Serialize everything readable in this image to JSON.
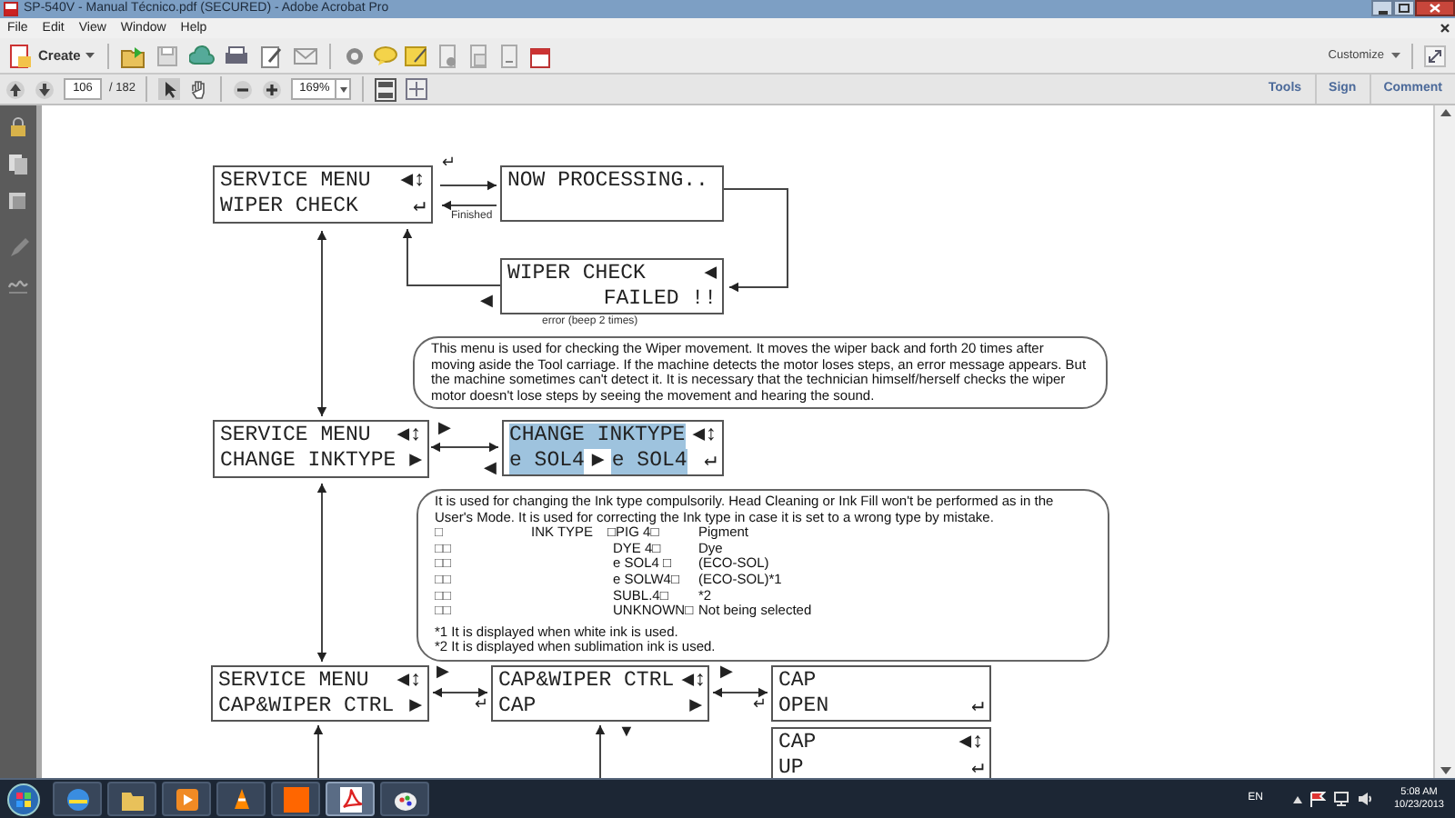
{
  "window": {
    "title": "SP-540V - Manual Técnico.pdf (SECURED) - Adobe Acrobat Pro"
  },
  "menu_bar": [
    {
      "label": "File"
    },
    {
      "label": "Edit"
    },
    {
      "label": "View"
    },
    {
      "label": "Window"
    },
    {
      "label": "Help"
    }
  ],
  "toolbar": {
    "create": "Create",
    "customize": "Customize"
  },
  "navigation": {
    "page": "106",
    "page_total": "/ 182",
    "zoom": "169%"
  },
  "panes": [
    {
      "label": "Tools"
    },
    {
      "label": "Sign"
    },
    {
      "label": "Comment"
    }
  ],
  "diagram": {
    "lcd_displays": [
      {
        "lines": [
          {
            "segments": [
              {
                "text": "SERVICE MENU",
                "highlighted": false
              }
            ],
            "end": "◀↕"
          },
          {
            "segments": [
              {
                "text": "WIPER CHECK",
                "highlighted": false
              }
            ],
            "end": "↵"
          }
        ]
      },
      {
        "lines": [
          {
            "segments": [
              {
                "text": "NOW PROCESSING..",
                "highlighted": false
              }
            ]
          }
        ]
      },
      {
        "lines": [
          {
            "segments": [
              {
                "text": "WIPER CHECK",
                "highlighted": false
              }
            ],
            "end": "◀"
          },
          {
            "end": "FAILED !!"
          }
        ]
      },
      {
        "lines": [
          {
            "segments": [
              {
                "text": "SERVICE MENU",
                "highlighted": false
              }
            ],
            "end": "◀↕"
          },
          {
            "segments": [
              {
                "text": "CHANGE INKTYPE",
                "highlighted": false
              }
            ],
            "end": "▶"
          }
        ]
      },
      {
        "lines": [
          {
            "segments": [
              {
                "text": "CHANGE INKTYPE",
                "highlighted": true
              }
            ],
            "end": "◀↕"
          },
          {
            "segments": [
              {
                "text": "e SOL4",
                "highlighted": true
              },
              {
                "text": "▶",
                "highlighted": false
              },
              {
                "text": "e SOL4",
                "highlighted": true
              }
            ],
            "end": "↵"
          }
        ]
      },
      {
        "lines": [
          {
            "segments": [
              {
                "text": "SERVICE MENU",
                "highlighted": false
              }
            ],
            "end": "◀↕"
          },
          {
            "segments": [
              {
                "text": "CAP&WIPER CTRL",
                "highlighted": false
              }
            ],
            "end": "▶"
          }
        ]
      },
      {
        "lines": [
          {
            "segments": [
              {
                "text": "CAP&WIPER CTRL",
                "highlighted": false
              }
            ],
            "end": "◀↕"
          },
          {
            "segments": [
              {
                "text": "CAP",
                "highlighted": false
              }
            ],
            "end": "▶"
          }
        ]
      },
      {
        "lines": [
          {
            "segments": [
              {
                "text": "CAP",
                "highlighted": false
              }
            ]
          },
          {
            "segments": [
              {
                "text": "OPEN",
                "highlighted": false
              }
            ],
            "end": "↵"
          }
        ]
      },
      {
        "lines": [
          {
            "segments": [
              {
                "text": "CAP",
                "highlighted": false
              }
            ],
            "end": "◀↕"
          },
          {
            "segments": [
              {
                "text": "UP",
                "highlighted": false
              }
            ],
            "end": "↵"
          }
        ]
      }
    ],
    "side_marks": [
      "↵",
      "◀",
      "▶",
      "◀",
      "▶",
      "↵",
      "▶",
      "↵",
      "▼"
    ],
    "labels": [
      {
        "text": "Finished"
      },
      {
        "text": "error (beep 2 times)"
      }
    ],
    "notes": [
      {
        "paragraph": "This menu is used for checking the Wiper movement. It moves the wiper back and forth 20 times after moving aside the Tool carriage. If the machine detects the motor loses steps, an error message appears. But the machine sometimes can't detect it. It is necessary that the technician himself/herself checks the wiper motor doesn't lose steps by seeing the movement and hearing the sound."
      },
      {
        "paragraph": "It is used for changing the Ink type compulsorily. Head Cleaning or Ink Fill won't be performed as in the User's Mode. It is used for correcting the Ink type in case it is set to a wrong type by mistake.",
        "table": [
          {
            "marker": "□",
            "heading": "INK TYPE",
            "value": "□PIG 4□",
            "meaning": "Pigment"
          },
          {
            "marker": "□□",
            "value": "DYE 4□",
            "meaning": "Dye"
          },
          {
            "marker": "□□",
            "value": "e SOL4 □",
            "meaning": "(ECO-SOL)"
          },
          {
            "marker": "□□",
            "value": "e SOLW4□",
            "meaning": "(ECO-SOL)*1"
          },
          {
            "marker": "□□",
            "value": "SUBL.4□",
            "meaning": "*2"
          },
          {
            "marker": "□□",
            "value": "UNKNOWN□",
            "meaning": "Not being selected"
          }
        ],
        "footnotes": [
          "*1 It is displayed when white ink is used.",
          "*2 It is displayed when sublimation ink is used."
        ]
      }
    ]
  },
  "taskbar": {
    "language": "EN",
    "time": "5:08 AM",
    "date": "10/23/2013"
  }
}
